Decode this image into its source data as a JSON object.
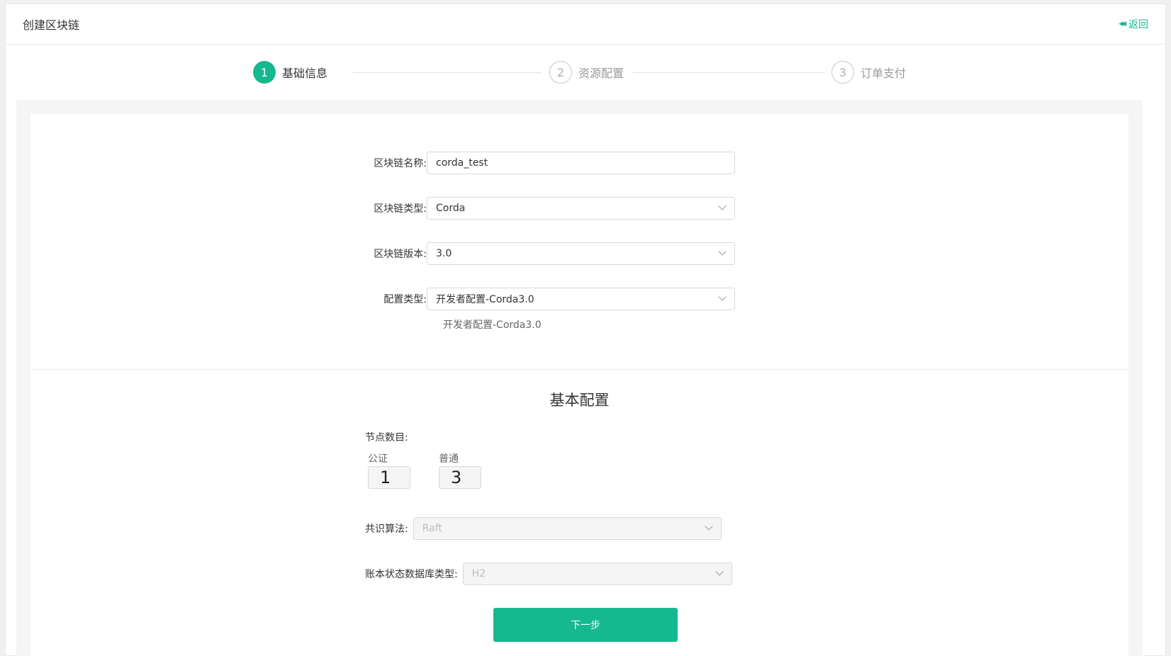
{
  "header": {
    "title": "创建区块链",
    "back_label": "返回"
  },
  "steps": [
    {
      "num": "1",
      "label": "基础信息",
      "state": "active"
    },
    {
      "num": "2",
      "label": "资源配置",
      "state": "idle"
    },
    {
      "num": "3",
      "label": "订单支付",
      "state": "idle"
    }
  ],
  "form": {
    "name": {
      "label": "区块链名称:",
      "value": "corda_test"
    },
    "type": {
      "label": "区块链类型:",
      "value": "Corda"
    },
    "version": {
      "label": "区块链版本:",
      "value": "3.0"
    },
    "config": {
      "label": "配置类型:",
      "value": "开发者配置-Corda3.0",
      "hint": "开发者配置-Corda3.0"
    }
  },
  "basic": {
    "title": "基本配置",
    "nodes_label": "节点数目:",
    "notary": {
      "label": "公证",
      "value": "1"
    },
    "normal": {
      "label": "普通",
      "value": "3"
    },
    "consensus": {
      "label": "共识算法:",
      "value": "Raft"
    },
    "db": {
      "label": "账本状态数据库类型:",
      "value": "H2"
    }
  },
  "actions": {
    "next_label": "下一步"
  },
  "colors": {
    "accent": "#16b98f"
  }
}
